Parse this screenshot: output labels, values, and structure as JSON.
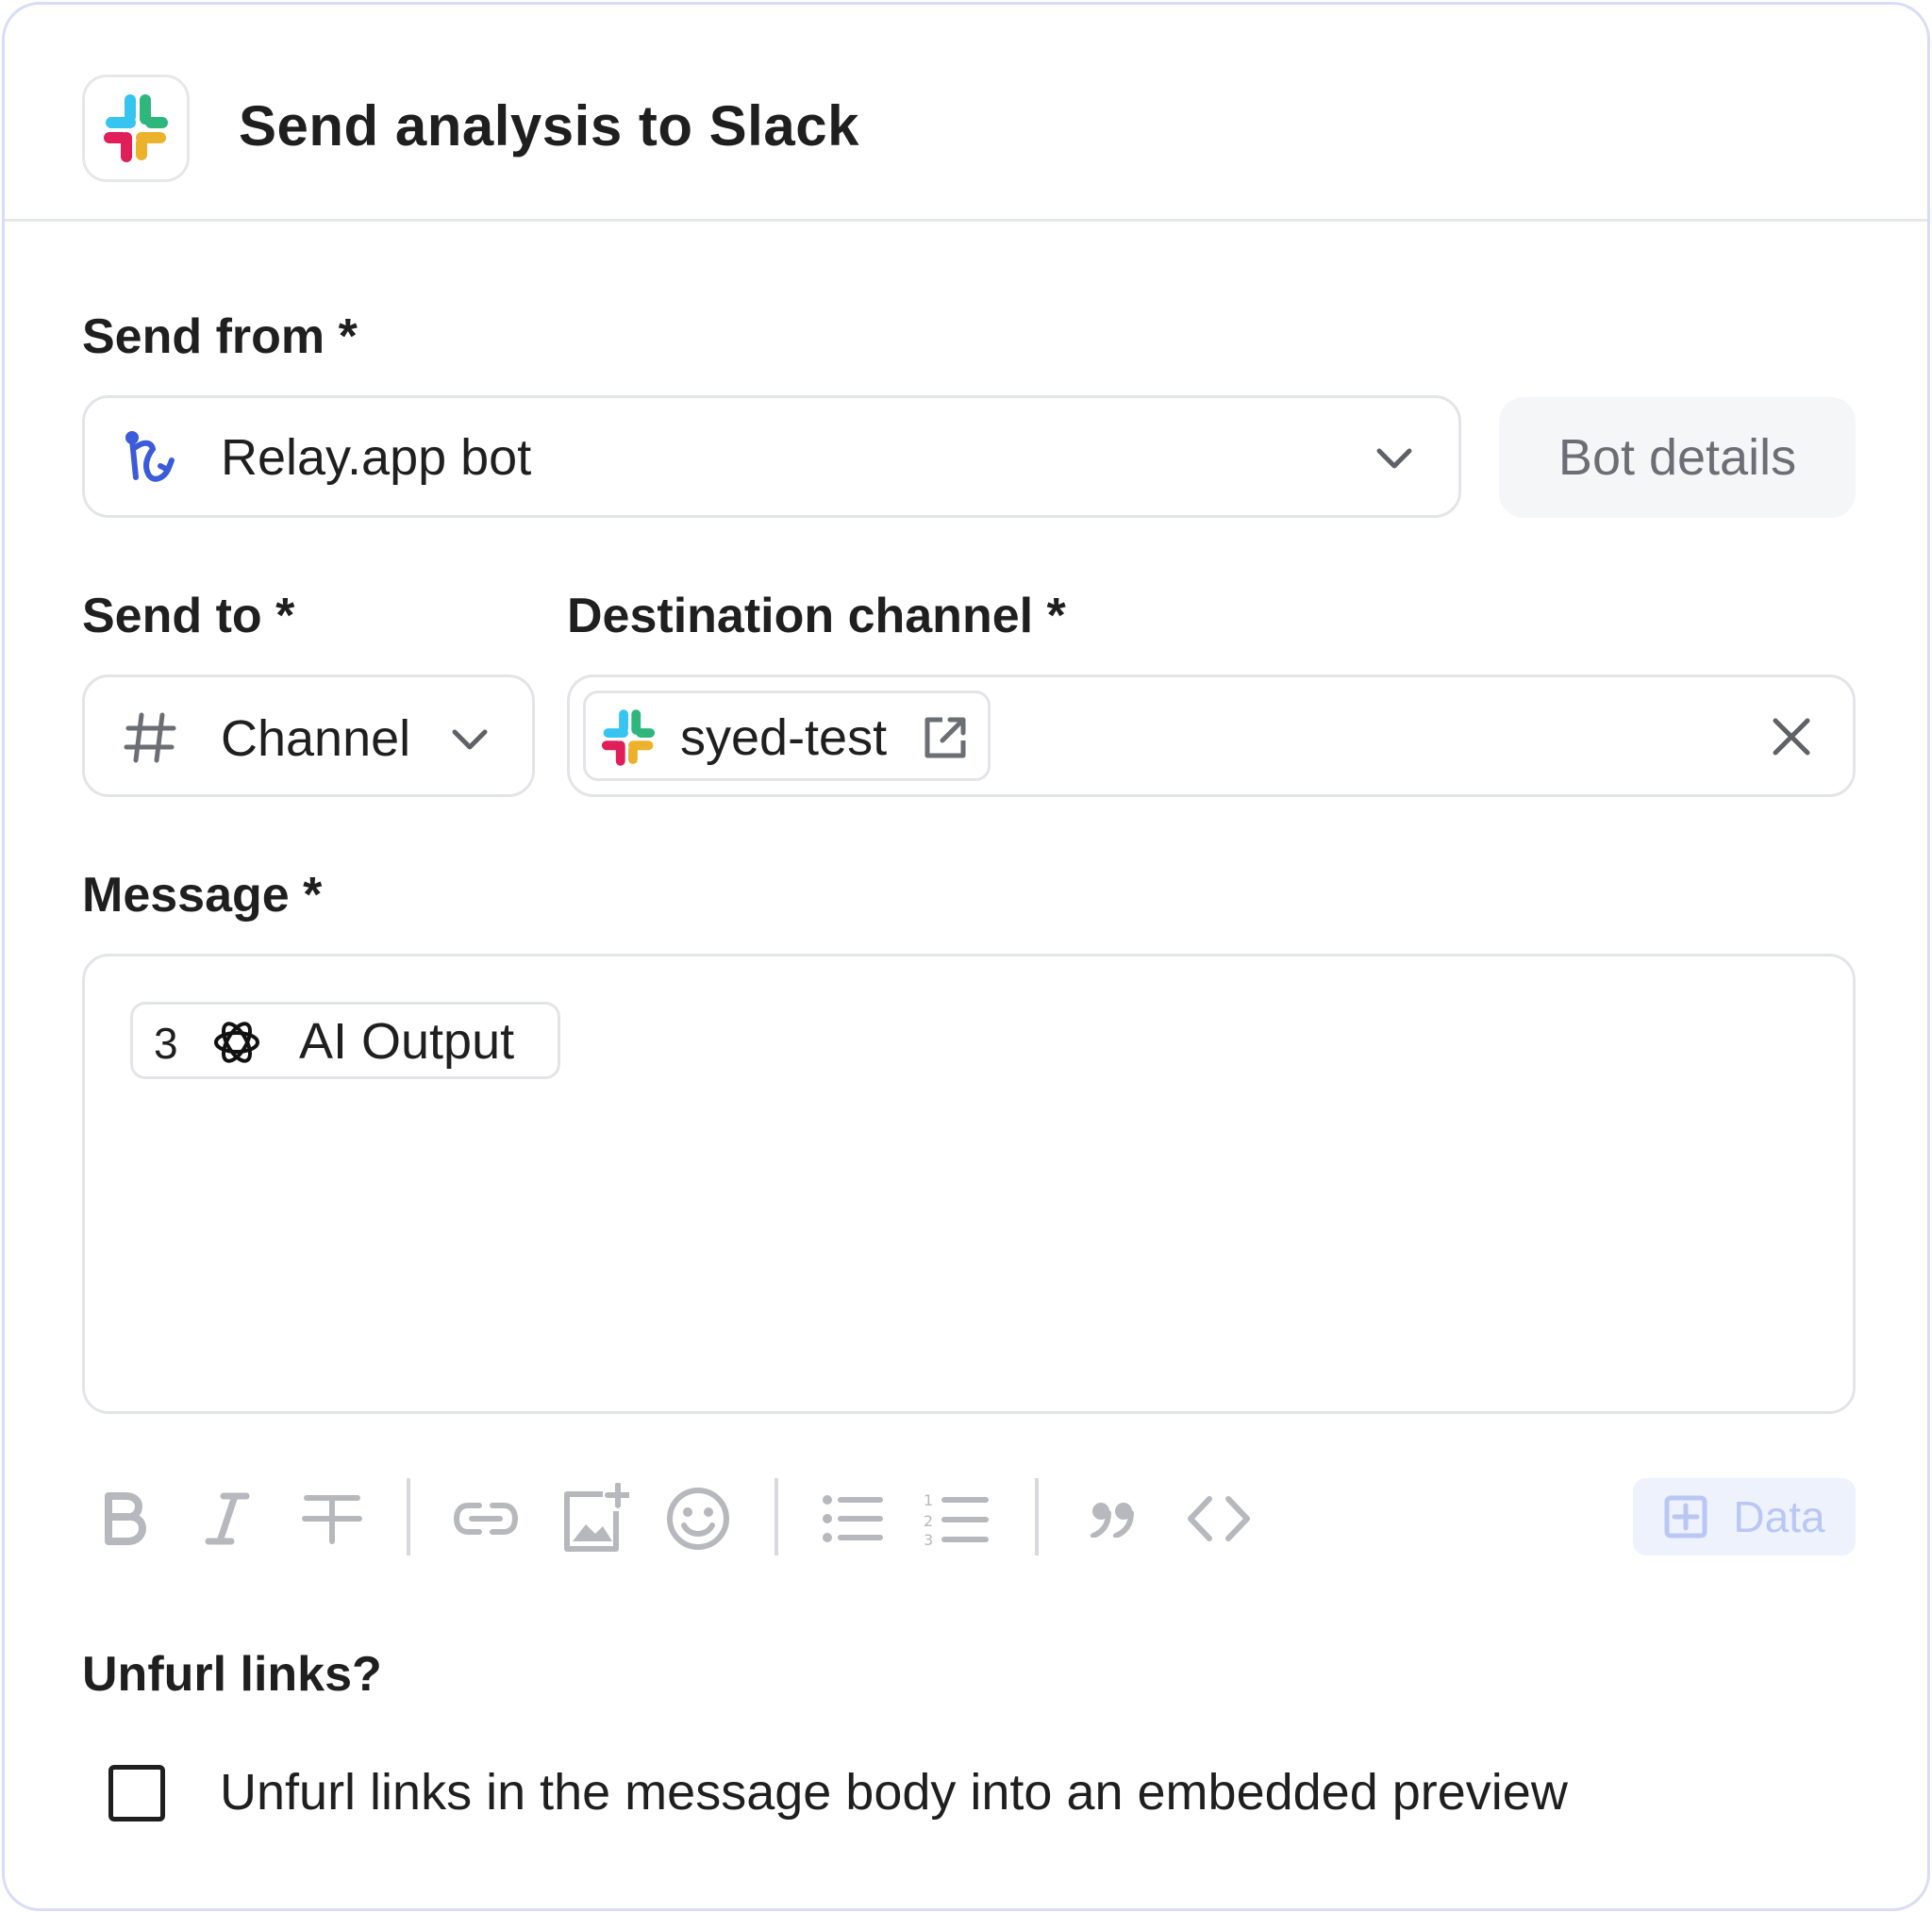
{
  "header": {
    "title": "Send analysis to Slack",
    "logo_icon": "slack-logo-icon"
  },
  "send_from": {
    "label": "Send from *",
    "value": "Relay.app bot",
    "icon": "relay-logo-icon",
    "bot_details_label": "Bot details"
  },
  "send_to": {
    "label": "Send to *",
    "value": "Channel",
    "icon": "hash-icon"
  },
  "destination": {
    "label": "Destination channel *",
    "chip_label": "syed-test"
  },
  "message": {
    "label": "Message *",
    "chip_step": "3",
    "chip_label": "AI Output"
  },
  "toolbar": {
    "data_label": "Data"
  },
  "unfurl": {
    "label": "Unfurl links?",
    "checkbox_label": "Unfurl links in the message body into an embedded preview",
    "checked": false
  },
  "colors": {
    "accent_blue": "#3b5bdb",
    "border": "#e3e4e8",
    "muted_icon": "#b7b8bd",
    "slack_blue": "#36c5f0",
    "slack_green": "#2eb67d",
    "slack_red": "#e01e5a",
    "slack_yellow": "#ecb22e"
  }
}
